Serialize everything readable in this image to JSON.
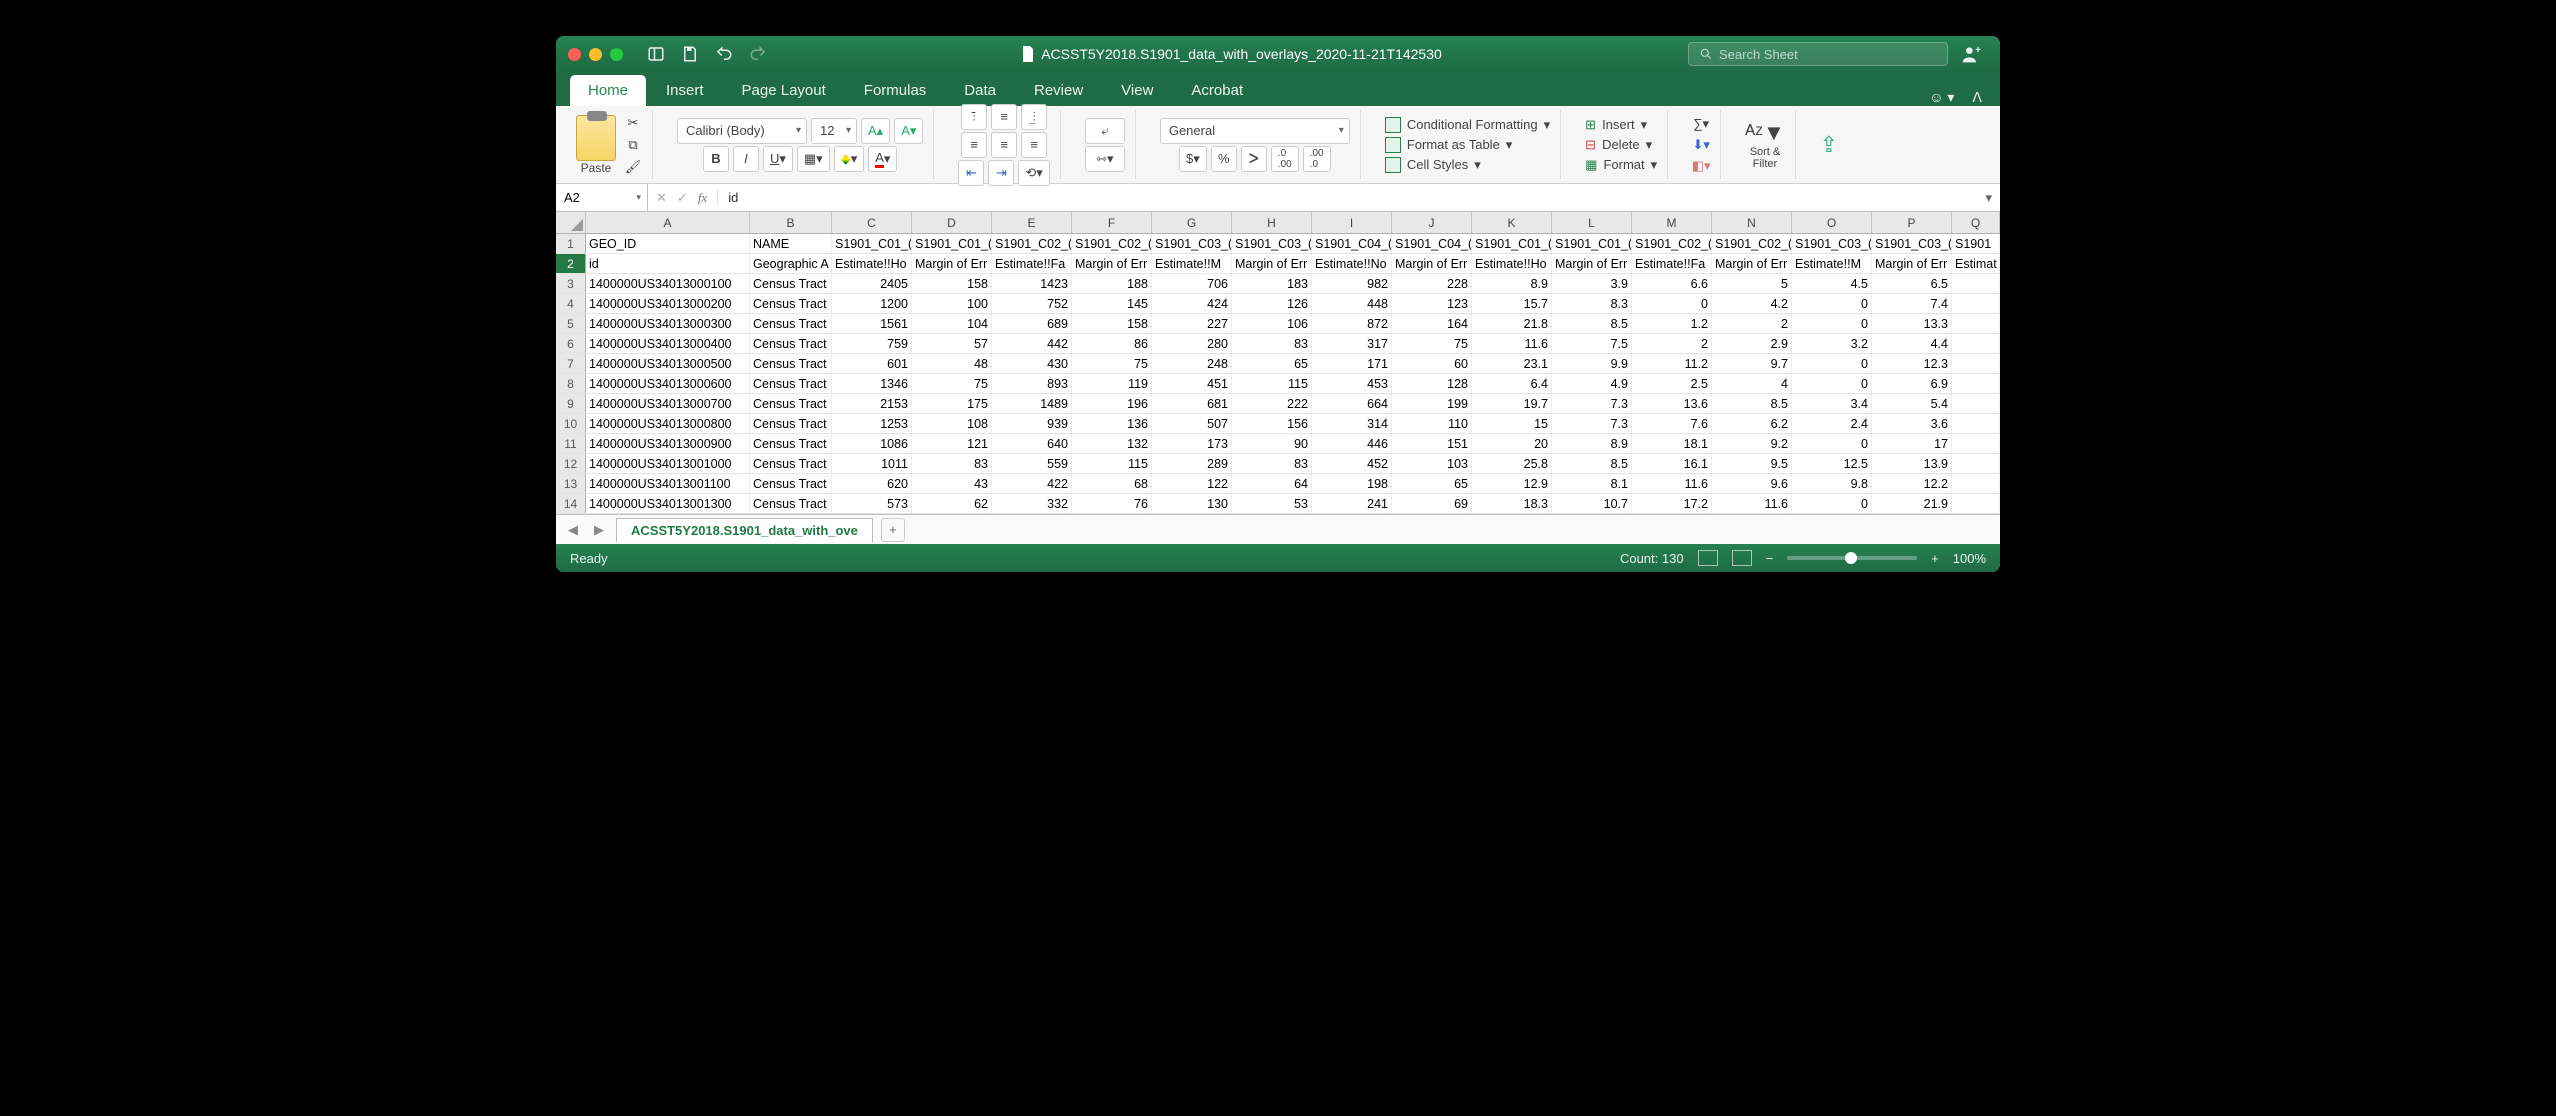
{
  "title": "ACSST5Y2018.S1901_data_with_overlays_2020-11-21T142530",
  "search_placeholder": "Search Sheet",
  "tabs": [
    "Home",
    "Insert",
    "Page Layout",
    "Formulas",
    "Data",
    "Review",
    "View",
    "Acrobat"
  ],
  "active_tab": "Home",
  "paste_label": "Paste",
  "font_name": "Calibri (Body)",
  "font_size": "12",
  "number_format": "General",
  "cell_options": {
    "cf": "Conditional Formatting",
    "fat": "Format as Table",
    "cs": "Cell Styles"
  },
  "cell_actions": {
    "insert": "Insert",
    "delete": "Delete",
    "format": "Format"
  },
  "sort_label": "Sort &\nFilter",
  "name_box": "A2",
  "formula": "id",
  "columns": [
    "A",
    "B",
    "C",
    "D",
    "E",
    "F",
    "G",
    "H",
    "I",
    "J",
    "K",
    "L",
    "M",
    "N",
    "O",
    "P",
    "Q"
  ],
  "rows": [
    {
      "n": "1",
      "c": [
        "GEO_ID",
        "NAME",
        "S1901_C01_(",
        "S1901_C01_(",
        "S1901_C02_(",
        "S1901_C02_(",
        "S1901_C03_(",
        "S1901_C03_(",
        "S1901_C04_(",
        "S1901_C04_(",
        "S1901_C01_(",
        "S1901_C01_(",
        "S1901_C02_(",
        "S1901_C02_(",
        "S1901_C03_(",
        "S1901_C03_(",
        "S1901"
      ]
    },
    {
      "n": "2",
      "c": [
        "id",
        "Geographic A",
        "Estimate!!Ho",
        "Margin of Err",
        "Estimate!!Fa",
        "Margin of Err",
        "Estimate!!M",
        "Margin of Err",
        "Estimate!!No",
        "Margin of Err",
        "Estimate!!Ho",
        "Margin of Err",
        "Estimate!!Fa",
        "Margin of Err",
        "Estimate!!M",
        "Margin of Err",
        "Estimat"
      ]
    },
    {
      "n": "3",
      "c": [
        "1400000US34013000100",
        "Census Tract",
        "2405",
        "158",
        "1423",
        "188",
        "706",
        "183",
        "982",
        "228",
        "8.9",
        "3.9",
        "6.6",
        "5",
        "4.5",
        "6.5",
        ""
      ]
    },
    {
      "n": "4",
      "c": [
        "1400000US34013000200",
        "Census Tract",
        "1200",
        "100",
        "752",
        "145",
        "424",
        "126",
        "448",
        "123",
        "15.7",
        "8.3",
        "0",
        "4.2",
        "0",
        "7.4",
        ""
      ]
    },
    {
      "n": "5",
      "c": [
        "1400000US34013000300",
        "Census Tract",
        "1561",
        "104",
        "689",
        "158",
        "227",
        "106",
        "872",
        "164",
        "21.8",
        "8.5",
        "1.2",
        "2",
        "0",
        "13.3",
        ""
      ]
    },
    {
      "n": "6",
      "c": [
        "1400000US34013000400",
        "Census Tract",
        "759",
        "57",
        "442",
        "86",
        "280",
        "83",
        "317",
        "75",
        "11.6",
        "7.5",
        "2",
        "2.9",
        "3.2",
        "4.4",
        ""
      ]
    },
    {
      "n": "7",
      "c": [
        "1400000US34013000500",
        "Census Tract",
        "601",
        "48",
        "430",
        "75",
        "248",
        "65",
        "171",
        "60",
        "23.1",
        "9.9",
        "11.2",
        "9.7",
        "0",
        "12.3",
        ""
      ]
    },
    {
      "n": "8",
      "c": [
        "1400000US34013000600",
        "Census Tract",
        "1346",
        "75",
        "893",
        "119",
        "451",
        "115",
        "453",
        "128",
        "6.4",
        "4.9",
        "2.5",
        "4",
        "0",
        "6.9",
        ""
      ]
    },
    {
      "n": "9",
      "c": [
        "1400000US34013000700",
        "Census Tract",
        "2153",
        "175",
        "1489",
        "196",
        "681",
        "222",
        "664",
        "199",
        "19.7",
        "7.3",
        "13.6",
        "8.5",
        "3.4",
        "5.4",
        ""
      ]
    },
    {
      "n": "10",
      "c": [
        "1400000US34013000800",
        "Census Tract",
        "1253",
        "108",
        "939",
        "136",
        "507",
        "156",
        "314",
        "110",
        "15",
        "7.3",
        "7.6",
        "6.2",
        "2.4",
        "3.6",
        ""
      ]
    },
    {
      "n": "11",
      "c": [
        "1400000US34013000900",
        "Census Tract",
        "1086",
        "121",
        "640",
        "132",
        "173",
        "90",
        "446",
        "151",
        "20",
        "8.9",
        "18.1",
        "9.2",
        "0",
        "17",
        ""
      ]
    },
    {
      "n": "12",
      "c": [
        "1400000US34013001000",
        "Census Tract",
        "1011",
        "83",
        "559",
        "115",
        "289",
        "83",
        "452",
        "103",
        "25.8",
        "8.5",
        "16.1",
        "9.5",
        "12.5",
        "13.9",
        ""
      ]
    },
    {
      "n": "13",
      "c": [
        "1400000US34013001100",
        "Census Tract",
        "620",
        "43",
        "422",
        "68",
        "122",
        "64",
        "198",
        "65",
        "12.9",
        "8.1",
        "11.6",
        "9.6",
        "9.8",
        "12.2",
        ""
      ]
    },
    {
      "n": "14",
      "c": [
        "1400000US34013001300",
        "Census Tract",
        "573",
        "62",
        "332",
        "76",
        "130",
        "53",
        "241",
        "69",
        "18.3",
        "10.7",
        "17.2",
        "11.6",
        "0",
        "21.9",
        ""
      ]
    }
  ],
  "sheet_name": "ACSST5Y2018.S1901_data_with_ove",
  "status_ready": "Ready",
  "status_count": "Count: 130",
  "zoom": "100%"
}
